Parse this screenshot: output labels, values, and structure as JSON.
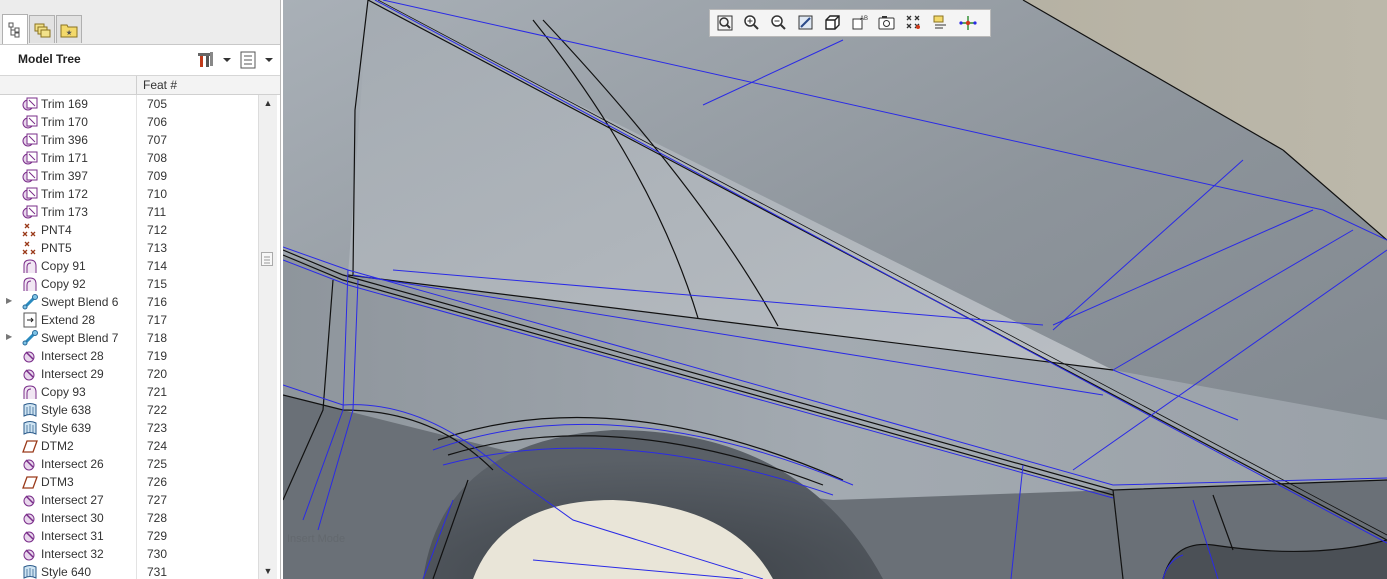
{
  "panel": {
    "title": "Model Tree",
    "column_header": "Feat #",
    "tabs": [
      {
        "icon": "model-tree-tab-icon"
      },
      {
        "icon": "layers-tab-icon"
      },
      {
        "icon": "favorites-tab-icon"
      }
    ]
  },
  "tree_items": [
    {
      "name": "Trim 169",
      "feat": "705",
      "icon": "trim-icon",
      "expandable": false
    },
    {
      "name": "Trim 170",
      "feat": "706",
      "icon": "trim-icon",
      "expandable": false
    },
    {
      "name": "Trim 396",
      "feat": "707",
      "icon": "trim-icon",
      "expandable": false
    },
    {
      "name": "Trim 171",
      "feat": "708",
      "icon": "trim-icon",
      "expandable": false
    },
    {
      "name": "Trim 397",
      "feat": "709",
      "icon": "trim-icon",
      "expandable": false
    },
    {
      "name": "Trim 172",
      "feat": "710",
      "icon": "trim-icon",
      "expandable": false
    },
    {
      "name": "Trim 173",
      "feat": "711",
      "icon": "trim-icon",
      "expandable": false
    },
    {
      "name": "PNT4",
      "feat": "712",
      "icon": "datum-point-icon",
      "expandable": false
    },
    {
      "name": "PNT5",
      "feat": "713",
      "icon": "datum-point-icon",
      "expandable": false
    },
    {
      "name": "Copy 91",
      "feat": "714",
      "icon": "copy-icon",
      "expandable": false
    },
    {
      "name": "Copy 92",
      "feat": "715",
      "icon": "copy-icon",
      "expandable": false
    },
    {
      "name": "Swept Blend 6",
      "feat": "716",
      "icon": "swept-blend-icon",
      "expandable": true
    },
    {
      "name": "Extend 28",
      "feat": "717",
      "icon": "extend-icon",
      "expandable": false
    },
    {
      "name": "Swept Blend 7",
      "feat": "718",
      "icon": "swept-blend-icon",
      "expandable": true
    },
    {
      "name": "Intersect 28",
      "feat": "719",
      "icon": "intersect-icon",
      "expandable": false
    },
    {
      "name": "Intersect 29",
      "feat": "720",
      "icon": "intersect-icon",
      "expandable": false
    },
    {
      "name": "Copy 93",
      "feat": "721",
      "icon": "copy-icon",
      "expandable": false
    },
    {
      "name": "Style 638",
      "feat": "722",
      "icon": "style-icon",
      "expandable": false
    },
    {
      "name": "Style 639",
      "feat": "723",
      "icon": "style-icon",
      "expandable": false
    },
    {
      "name": "DTM2",
      "feat": "724",
      "icon": "datum-plane-icon",
      "expandable": false
    },
    {
      "name": "Intersect 26",
      "feat": "725",
      "icon": "intersect-icon",
      "expandable": false
    },
    {
      "name": "DTM3",
      "feat": "726",
      "icon": "datum-plane-icon",
      "expandable": false
    },
    {
      "name": "Intersect 27",
      "feat": "727",
      "icon": "intersect-icon",
      "expandable": false
    },
    {
      "name": "Intersect 30",
      "feat": "728",
      "icon": "intersect-icon",
      "expandable": false
    },
    {
      "name": "Intersect 31",
      "feat": "729",
      "icon": "intersect-icon",
      "expandable": false
    },
    {
      "name": "Intersect 32",
      "feat": "730",
      "icon": "intersect-icon",
      "expandable": false
    },
    {
      "name": "Style 640",
      "feat": "731",
      "icon": "style-icon",
      "expandable": false
    }
  ],
  "viewport": {
    "faint_label": "Insert Mode",
    "toolbar": [
      "refit-icon",
      "zoom-in-icon",
      "zoom-out-icon",
      "repaint-icon",
      "display-style-icon",
      "saved-orientations-icon",
      "view-manager-icon",
      "datum-display-icon",
      "annotation-display-icon",
      "spin-center-icon"
    ]
  },
  "colors": {
    "accent_edge": "#2a2ae6",
    "tree_icon": "#7a2d8a",
    "point_icon": "#9a3a1a"
  }
}
